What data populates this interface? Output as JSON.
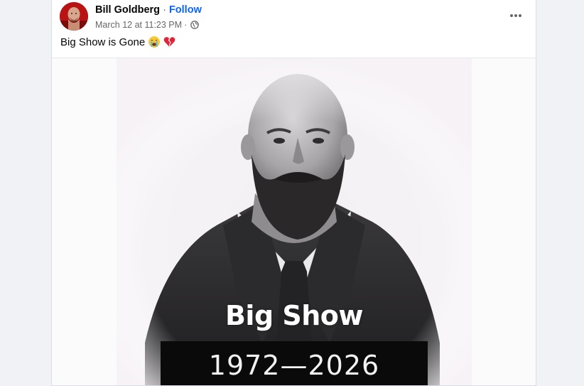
{
  "post": {
    "author": "Bill Goldberg",
    "separator": "·",
    "follow_label": "Follow",
    "timestamp": "March 12 at 11:23 PM",
    "meta_separator": "·",
    "privacy_icon": "globe-icon",
    "more_icon": "more-options-icon",
    "caption": "Big Show is Gone",
    "caption_emojis": [
      "crying-face-emoji",
      "broken-heart-emoji"
    ]
  },
  "image": {
    "name_text": "Big Show",
    "years_text": "1972—2026"
  },
  "colors": {
    "follow_blue": "#0866ff",
    "page_background": "#f0f2f5",
    "secondary_text": "#65676b"
  }
}
